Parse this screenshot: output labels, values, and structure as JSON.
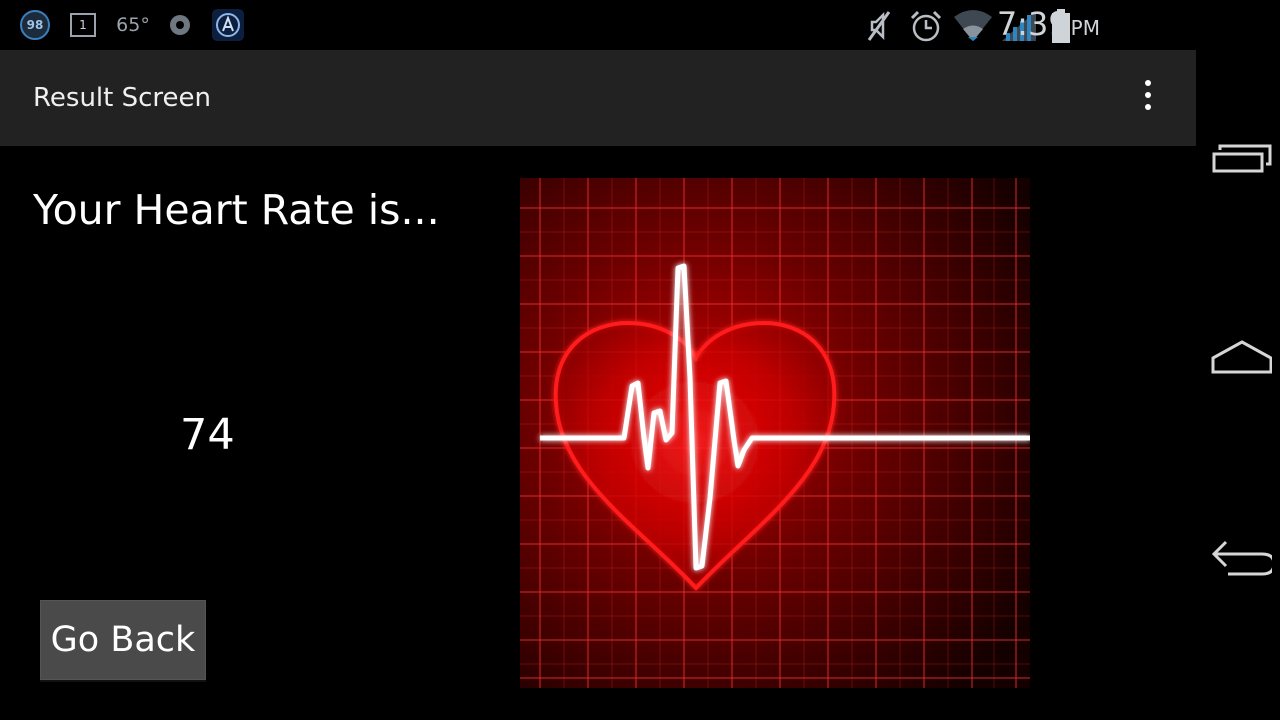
{
  "status_bar": {
    "battery_badge": "98",
    "calendar_day": "1",
    "temperature": "65°",
    "time": "7:39",
    "ampm": "PM",
    "icons": [
      "battery-badge-icon",
      "calendar-icon",
      "weather-icon",
      "sync-icon",
      "app-icon",
      "mute-icon",
      "alarm-icon",
      "wifi-icon",
      "signal-icon",
      "battery-icon"
    ]
  },
  "action_bar": {
    "title": "Result Screen",
    "overflow_icon": "overflow-menu-icon"
  },
  "main": {
    "heading": "Your Heart Rate is...",
    "heart_rate": "74",
    "go_back_label": "Go Back",
    "image": "heart-ekg-image"
  },
  "nav_bar": {
    "icons": [
      "recent-apps-icon",
      "home-icon",
      "back-icon"
    ]
  },
  "colors": {
    "action_bar_bg": "#222222",
    "background": "#000000",
    "button_bg": "#4a4a4a",
    "heart_red": "#e01010"
  }
}
